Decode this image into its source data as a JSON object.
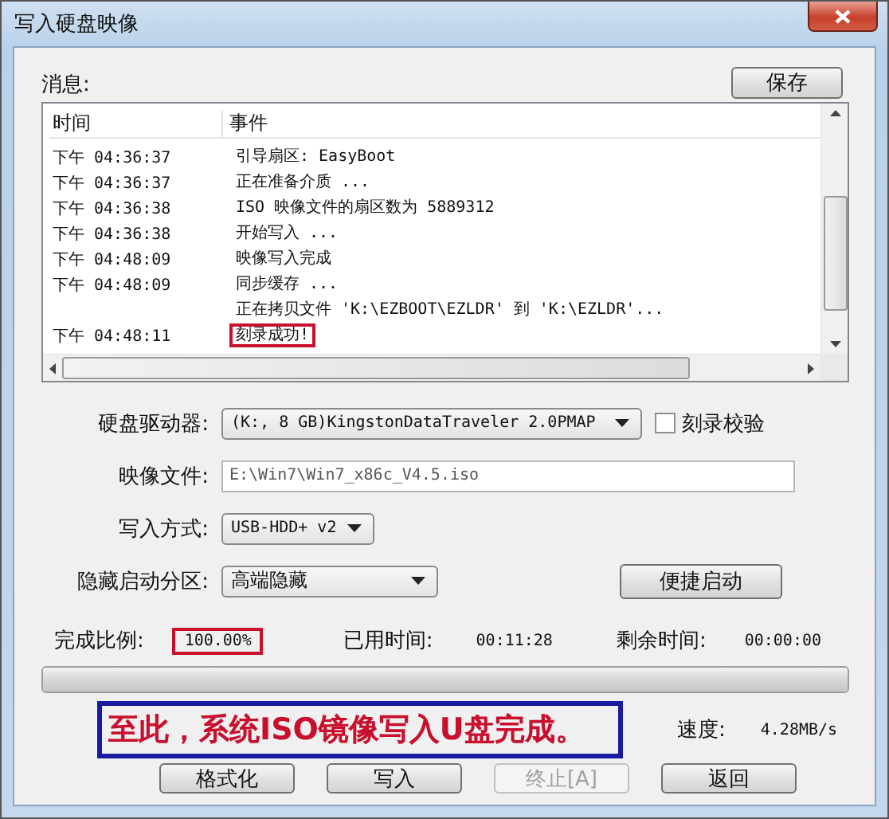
{
  "window": {
    "title": "写入硬盘映像"
  },
  "messages": {
    "label": "消息:",
    "save_button": "保存",
    "columns": [
      "时间",
      "事件"
    ],
    "rows": [
      {
        "time": "下午 04:36:37",
        "event": "引导扇区: EasyBoot",
        "highlighted": false
      },
      {
        "time": "下午 04:36:37",
        "event": "正在准备介质 ...",
        "highlighted": false
      },
      {
        "time": "下午 04:36:38",
        "event": "ISO 映像文件的扇区数为 5889312",
        "highlighted": false
      },
      {
        "time": "下午 04:36:38",
        "event": "开始写入 ...",
        "highlighted": false
      },
      {
        "time": "下午 04:48:09",
        "event": "映像写入完成",
        "highlighted": false
      },
      {
        "time": "下午 04:48:09",
        "event": "同步缓存 ...",
        "highlighted": false
      },
      {
        "event": "正在拷贝文件 'K:\\EZBOOT\\EZLDR' 到 'K:\\EZLDR'...",
        "highlighted": false
      },
      {
        "time": "下午 04:48:11",
        "event": "刻录成功!",
        "highlighted": true
      }
    ]
  },
  "drive": {
    "label": "硬盘驱动器:",
    "value": "(K:, 8 GB)KingstonDataTraveler 2.0PMAP",
    "verify": {
      "label": "刻录校验",
      "checked": false
    }
  },
  "image_file": {
    "label": "映像文件:",
    "value": "E:\\Win7\\Win7_x86c_V4.5.iso"
  },
  "write_mode": {
    "label": "写入方式:",
    "value": "USB-HDD+ v2"
  },
  "hide_partition": {
    "label": "隐藏启动分区:",
    "value": "高端隐藏",
    "button": "便捷启动"
  },
  "progress": {
    "percent_label": "完成比例:",
    "percent": "100.00%",
    "percent_highlighted": true,
    "elapsed_label": "已用时间:",
    "elapsed": "00:11:28",
    "remaining_label": "剩余时间:",
    "remaining": "00:00:00",
    "level": 1,
    "speed_label": "速度:",
    "speed": "4.28MB/s"
  },
  "note": {
    "text": "至此，系统ISO镜像写入U盘完成。"
  },
  "buttons": [
    {
      "label": "格式化",
      "disabled": false
    },
    {
      "label": "写入",
      "disabled": false
    },
    {
      "label": "终止[A]",
      "disabled": true
    },
    {
      "label": "返回",
      "disabled": false
    }
  ]
}
